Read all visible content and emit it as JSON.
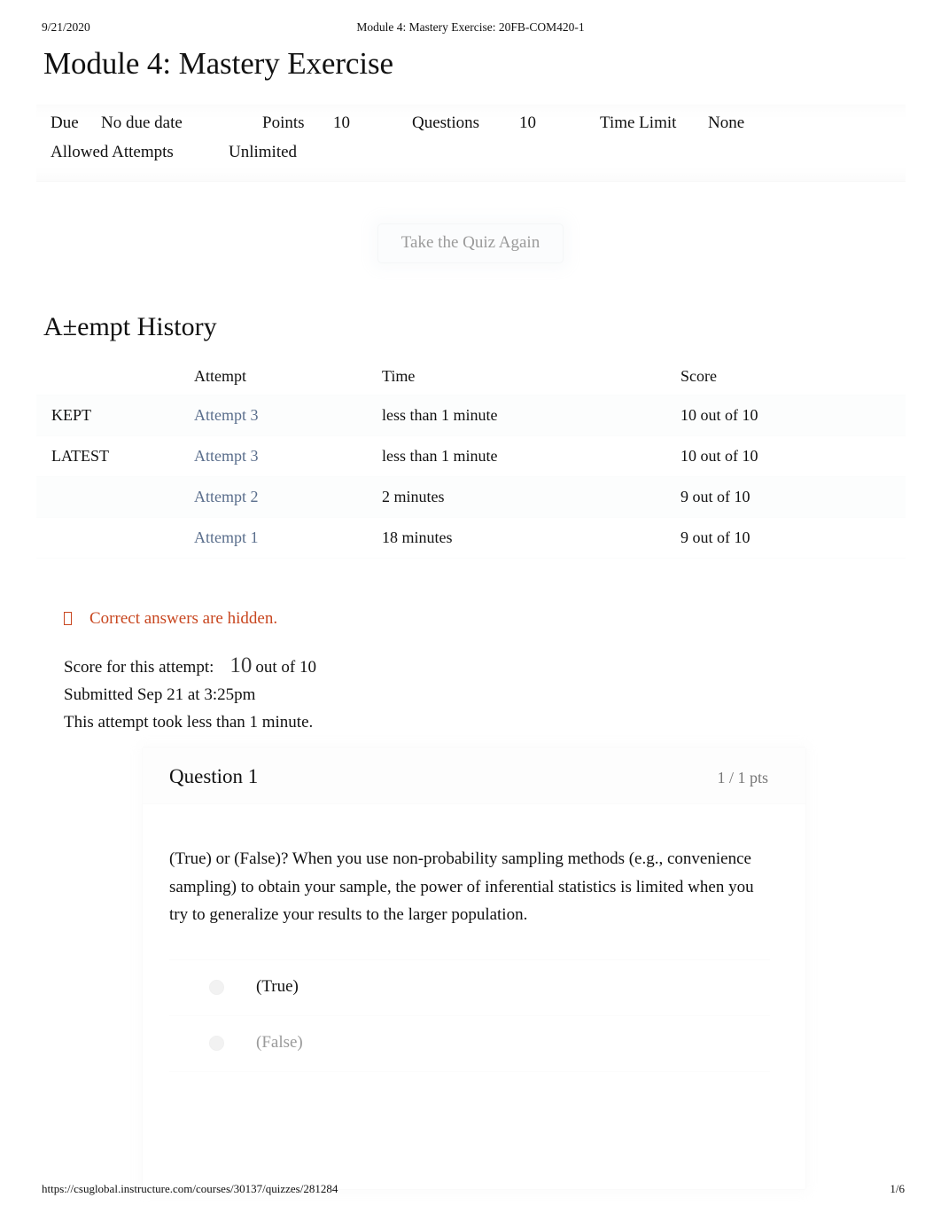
{
  "print_header": {
    "date": "9/21/2020",
    "document_title": "Module 4: Mastery Exercise: 20FB-COM420-1"
  },
  "page_title": "Module 4: Mastery Exercise",
  "quiz_details": {
    "due_label": "Due",
    "due_value": "No due date",
    "points_label": "Points",
    "points_value": "10",
    "questions_label": "Questions",
    "questions_value": "10",
    "time_limit_label": "Time Limit",
    "time_limit_value": "None",
    "allowed_attempts_label": "Allowed Attempts",
    "allowed_attempts_value": "Unlimited"
  },
  "retake_button": "Take the Quiz Again",
  "attempt_history": {
    "heading": "A±empt History",
    "columns": [
      "",
      "Attempt",
      "Time",
      "Score"
    ],
    "rows": [
      {
        "flag": "KEPT",
        "attempt": "Attempt 3",
        "time": "less than 1 minute",
        "score": "10 out of 10"
      },
      {
        "flag": "LATEST",
        "attempt": "Attempt 3",
        "time": "less than 1 minute",
        "score": "10 out of 10"
      },
      {
        "flag": "",
        "attempt": "Attempt 2",
        "time": "2 minutes",
        "score": "9 out of 10"
      },
      {
        "flag": "",
        "attempt": "Attempt 1",
        "time": "18 minutes",
        "score": "9 out of 10"
      }
    ]
  },
  "notice": "Correct answers are hidden.",
  "attempt_summary": {
    "score_label": "Score for this attempt:",
    "score_value": "10",
    "score_suffix": "out of 10",
    "submitted": "Submitted Sep 21 at 3:25pm",
    "duration": "This attempt took less than 1 minute."
  },
  "question": {
    "title": "Question 1",
    "points": "1 / 1 pts",
    "text": "(True) or (False)? When you use non-probability sampling methods (e.g., convenience sampling) to obtain your sample, the power of inferential statistics is limited when you try to generalize your results to the larger population.",
    "answers": [
      {
        "label": "(True)"
      },
      {
        "label": "(False)"
      }
    ]
  },
  "print_footer": {
    "url": "https://csuglobal.instructure.com/courses/30137/quizzes/281284",
    "page": "1/6"
  },
  "colors": {
    "link": "#5a6e8c",
    "notice": "#c8461f",
    "muted_text": "#9a9a9a",
    "body_text": "#111111"
  }
}
